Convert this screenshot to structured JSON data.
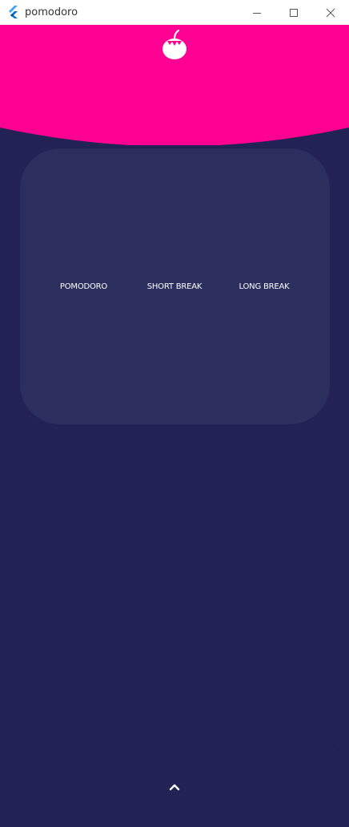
{
  "window": {
    "title": "pomodoro",
    "controls": [
      "minimize",
      "maximize",
      "close"
    ],
    "app_icon": "flutter-icon"
  },
  "header": {
    "icon": "tomato-icon",
    "color": "#ff0093"
  },
  "modes": {
    "tabs": [
      {
        "label": "POMODORO"
      },
      {
        "label": "SHORT BREAK"
      },
      {
        "label": "LONG BREAK"
      }
    ]
  },
  "footer": {
    "icon": "chevron-up-icon"
  },
  "colors": {
    "background": "#222354",
    "card": "#2c2e5e",
    "accent": "#ff0093",
    "titlebar": "#ffffff"
  }
}
